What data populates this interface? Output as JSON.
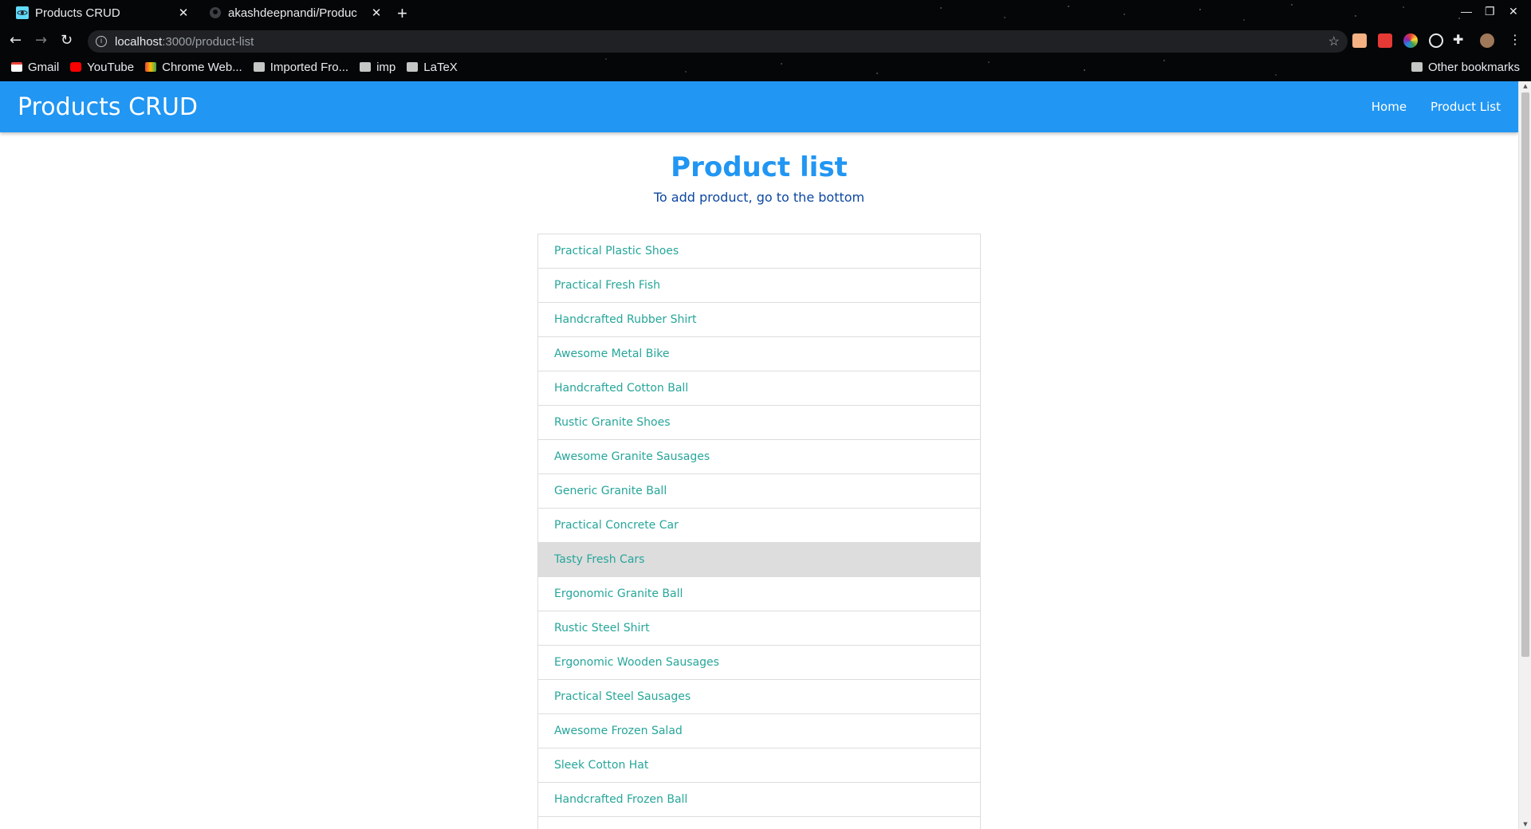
{
  "browser": {
    "tabs": [
      {
        "title": "Products CRUD",
        "active": true
      },
      {
        "title": "akashdeepnandi/Produc",
        "active": false
      }
    ],
    "newtab_symbol": "+",
    "url_host": "localhost",
    "url_path": ":3000/product-list",
    "bookmarks": [
      {
        "label": "Gmail",
        "icon": "gmail-icon"
      },
      {
        "label": "YouTube",
        "icon": "youtube-icon"
      },
      {
        "label": "Chrome Web...",
        "icon": "chrome-webstore-icon"
      },
      {
        "label": "Imported Fro...",
        "icon": "folder-icon"
      },
      {
        "label": "imp",
        "icon": "folder-icon"
      },
      {
        "label": "LaTeX",
        "icon": "folder-icon"
      }
    ],
    "other_bookmarks": "Other bookmarks"
  },
  "navbar": {
    "brand": "Products CRUD",
    "links": [
      "Home",
      "Product List"
    ],
    "color": "#2196f3"
  },
  "main": {
    "title": "Product list",
    "subtitle": "To add product, go to the bottom",
    "products": [
      "Practical Plastic Shoes",
      "Practical Fresh Fish",
      "Handcrafted Rubber Shirt",
      "Awesome Metal Bike",
      "Handcrafted Cotton Ball",
      "Rustic Granite Shoes",
      "Awesome Granite Sausages",
      "Generic Granite Ball",
      "Practical Concrete Car",
      "Tasty Fresh Cars",
      "Ergonomic Granite Ball",
      "Rustic Steel Shirt",
      "Ergonomic Wooden Sausages",
      "Practical Steel Sausages",
      "Awesome Frozen Salad",
      "Sleek Cotton Hat",
      "Handcrafted Frozen Ball",
      ""
    ],
    "hovered_product": "Tasty Fresh Cars",
    "link_color": "#26a69a"
  }
}
